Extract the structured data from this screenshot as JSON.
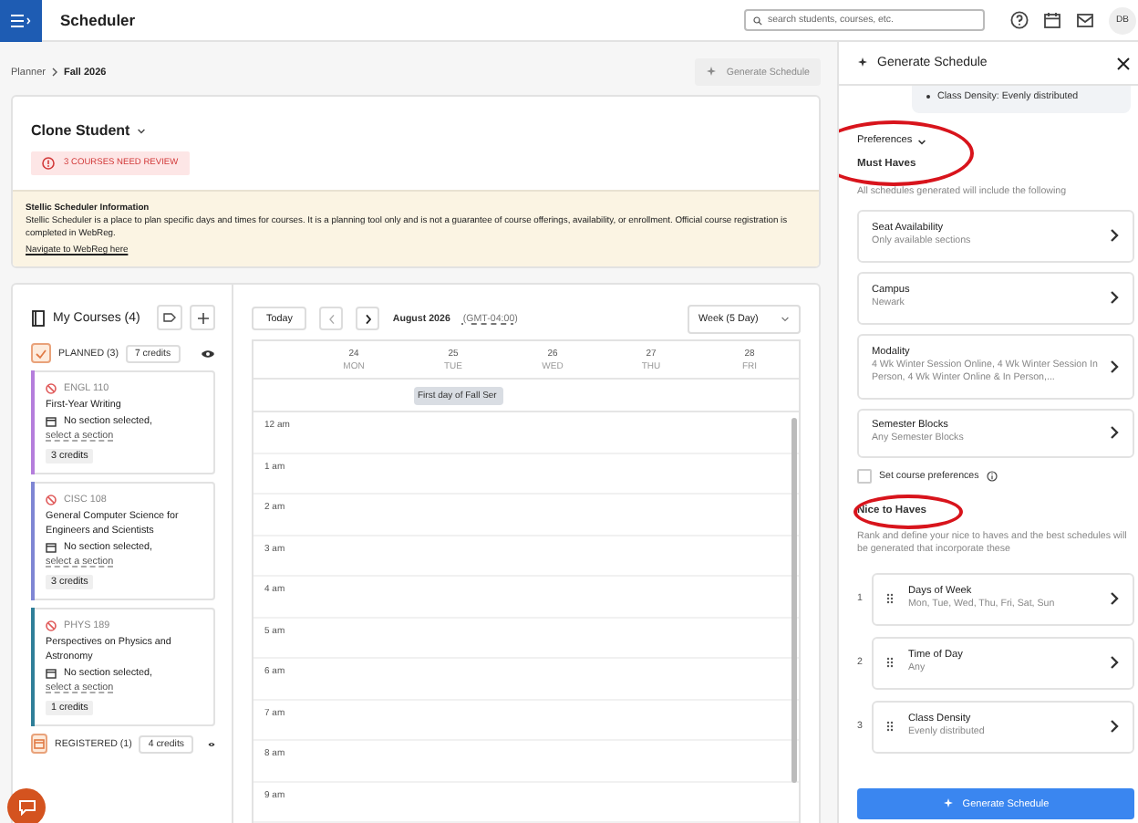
{
  "topbar": {
    "title": "Scheduler",
    "search": {
      "placeholder": "search students, courses, etc."
    },
    "avatar": "DB"
  },
  "breadcrumb": [
    "Planner",
    "Fall 2026"
  ],
  "generate_button": {
    "label": "Generate Schedule",
    "disabled": true
  },
  "student": {
    "name": "Clone Student",
    "review_badge": "3 COURSES NEED REVIEW"
  },
  "info": {
    "title": "Stellic Scheduler Information",
    "text": "Stellic Scheduler is a place to plan specific days and times for courses. It is a planning tool only and is not a guarantee of course offerings, availability, or enrollment. Official course registration is completed in WebReg.",
    "link": "Navigate to WebReg here"
  },
  "courses": {
    "title": "My Courses (4)",
    "groups": [
      {
        "kind": "planned",
        "label": "PLANNED (3)",
        "credits": "7 credits",
        "courses": [
          {
            "code": "ENGL 110",
            "title": "First-Year Writing",
            "section_status": "No section selected,",
            "action": "select a section",
            "credits": "3 credits",
            "color": "#b57edc"
          },
          {
            "code": "CISC 108",
            "title": "General Computer Science for Engineers and Scientists",
            "section_status": "No section selected,",
            "action": "select a section",
            "credits": "3 credits",
            "color": "#7f86d4"
          },
          {
            "code": "PHYS 189",
            "title": "Perspectives on Physics and Astronomy",
            "section_status": "No section selected,",
            "action": "select a section",
            "credits": "1 credits",
            "color": "#2f7f99"
          }
        ]
      },
      {
        "kind": "registered",
        "label": "REGISTERED (1)",
        "credits": "4 credits"
      }
    ]
  },
  "calendar": {
    "today": "Today",
    "month": "August 2026",
    "timezone": "(GMT-04:00)",
    "view": "Week (5 Day)",
    "days": [
      {
        "date": "24",
        "weekday": "MON"
      },
      {
        "date": "25",
        "weekday": "TUE",
        "all_day_event": "First day of Fall Ser"
      },
      {
        "date": "26",
        "weekday": "WED"
      },
      {
        "date": "27",
        "weekday": "THU"
      },
      {
        "date": "28",
        "weekday": "FRI"
      }
    ],
    "hours": [
      "12 am",
      "1 am",
      "2 am",
      "3 am",
      "4 am",
      "5 am",
      "6 am",
      "7 am",
      "8 am",
      "9 am"
    ]
  },
  "panel": {
    "title": "Generate Schedule",
    "summary": [
      "Class Density: Evenly distributed"
    ],
    "preferences": {
      "label": "Preferences",
      "expanded": true,
      "annotated": true
    },
    "must_haves": {
      "title": "Must Haves",
      "subtitle": "All schedules generated will include the following",
      "items": [
        {
          "title": "Seat Availability",
          "value": "Only available sections"
        },
        {
          "title": "Campus",
          "value": "Newark"
        },
        {
          "title": "Modality",
          "value": "4 Wk Winter Session Online, 4 Wk Winter Session In Person, 4 Wk Winter Online & In Person,..."
        },
        {
          "title": "Semester Blocks",
          "value": "Any Semester Blocks"
        }
      ]
    },
    "course_preferences": {
      "label": "Set course preferences",
      "checked": false
    },
    "nice_to_haves": {
      "title": "Nice to Haves",
      "annotated": true,
      "subtitle": "Rank and define your nice to haves and the best schedules will be generated that incorporate these",
      "items": [
        {
          "rank": "1",
          "title": "Days of Week",
          "value": "Mon, Tue, Wed, Thu, Fri, Sat, Sun"
        },
        {
          "rank": "2",
          "title": "Time of Day",
          "value": "Any"
        },
        {
          "rank": "3",
          "title": "Class Density",
          "value": "Evenly distributed"
        }
      ]
    },
    "button": "Generate Schedule"
  }
}
